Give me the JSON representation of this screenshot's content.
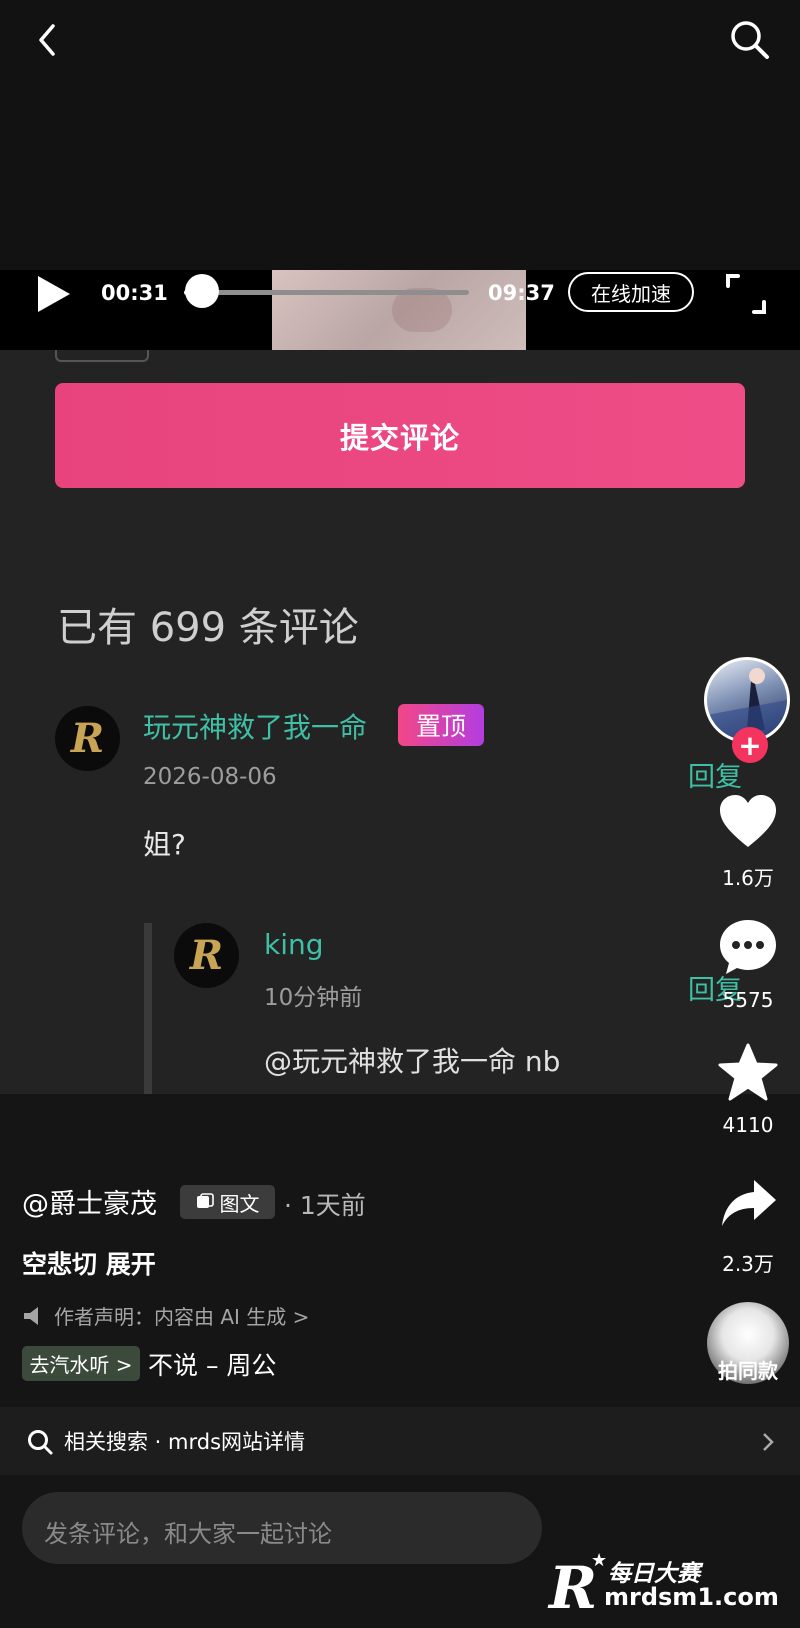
{
  "player": {
    "current_time": "00:31",
    "duration": "09:37",
    "progress": 0.054,
    "speed_button": "在线加速"
  },
  "comments_panel": {
    "submit_label": "提交评论",
    "count_text": "已有 699 条评论",
    "comments": [
      {
        "username": "玩元神救了我一命",
        "pin_badge": "置顶",
        "date": "2026-08-06",
        "text": "姐?",
        "reply_label": "回复",
        "avatar_letter": "R"
      }
    ],
    "replies": [
      {
        "username": "king",
        "time": "10分钟前",
        "text": "@玩元神救了我一命 nb",
        "reply_label": "回复",
        "avatar_letter": "R"
      }
    ]
  },
  "rail": {
    "likes": "1.6万",
    "comments": "5575",
    "favorites": "4110",
    "shares": "2.3万",
    "same_style": "拍同款",
    "follow": "+"
  },
  "post": {
    "author": "@爵士豪茂",
    "type_badge": "图文",
    "time_ago": "· 1天前",
    "caption": "空悲切  展开",
    "disclaimer": "作者声明：内容由 AI 生成 >",
    "music_chip": "去汽水听 >",
    "music": "不说 – 周公"
  },
  "related_search": "相关搜索 · mrds网站详情",
  "comment_input_placeholder": "发条评论，和大家一起讨论",
  "watermark": {
    "brand": "每日大赛",
    "domain": "mrdsm1.com"
  }
}
